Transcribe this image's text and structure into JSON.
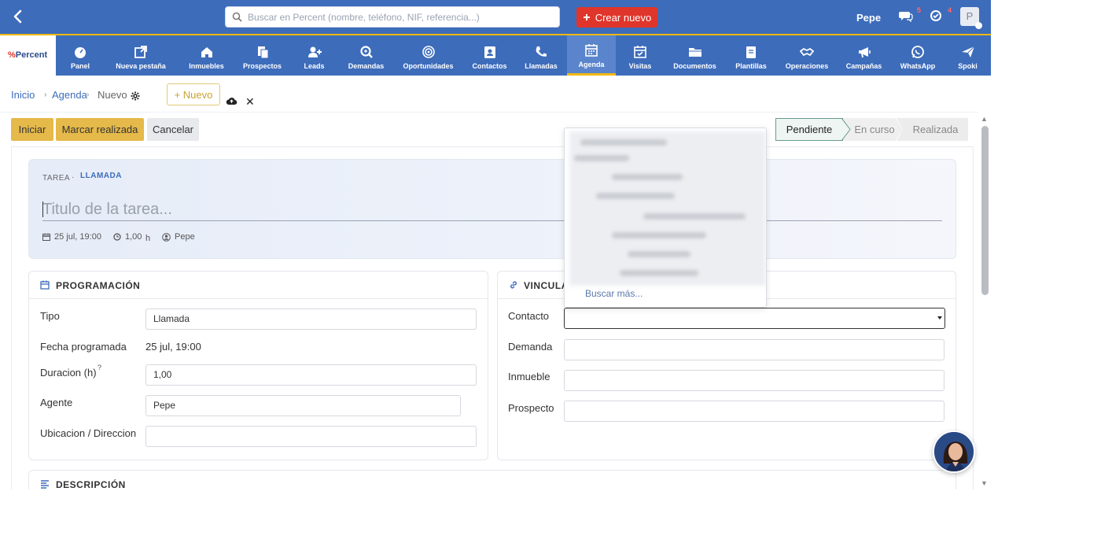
{
  "topbar": {
    "search_placeholder": "Buscar en Percent (nombre, teléfono, NIF, referencia...)",
    "create_label": "Crear nuevo",
    "user_name": "Pepe",
    "messages_count": "5",
    "notifications_count": "4",
    "avatar_letter": "P"
  },
  "logo": {
    "brand_prefix": "%",
    "brand_name": "Percent"
  },
  "nav": [
    {
      "label": "Panel",
      "icon": "dashboard-icon"
    },
    {
      "label": "Nueva pestaña",
      "icon": "new-tab-icon"
    },
    {
      "label": "Inmuebles",
      "icon": "home-icon"
    },
    {
      "label": "Prospectos",
      "icon": "documents-icon"
    },
    {
      "label": "Leads",
      "icon": "add-user-icon"
    },
    {
      "label": "Demandas",
      "icon": "search-icon"
    },
    {
      "label": "Oportunidades",
      "icon": "target-icon"
    },
    {
      "label": "Contactos",
      "icon": "contact-card-icon"
    },
    {
      "label": "Llamadas",
      "icon": "phone-icon"
    },
    {
      "label": "Agenda",
      "icon": "calendar-icon",
      "active": true
    },
    {
      "label": "Visitas",
      "icon": "calendar-check-icon"
    },
    {
      "label": "Documentos",
      "icon": "folder-icon"
    },
    {
      "label": "Plantillas",
      "icon": "template-icon"
    },
    {
      "label": "Operaciones",
      "icon": "handshake-icon"
    },
    {
      "label": "Campañas",
      "icon": "megaphone-icon"
    },
    {
      "label": "WhatsApp",
      "icon": "whatsapp-icon"
    },
    {
      "label": "Spoki",
      "icon": "send-icon"
    }
  ],
  "breadcrumb": {
    "home": "Inicio",
    "section": "Agenda",
    "current": "Nuevo"
  },
  "toolbar": {
    "new_label": "+ Nuevo"
  },
  "actions": {
    "start": "Iniciar",
    "mark_done": "Marcar realizada",
    "cancel": "Cancelar"
  },
  "status_steps": [
    "Pendiente",
    "En curso",
    "Realizada"
  ],
  "task": {
    "type": "TAREA",
    "separator": "·",
    "subtype": "LLAMADA",
    "title_placeholder": "Titulo de la tarea...",
    "date": "25 jul, 19:00",
    "duration": "1,00",
    "duration_unit": "h",
    "agent": "Pepe"
  },
  "programacion": {
    "title": "PROGRAMACIÓN",
    "tipo_label": "Tipo",
    "tipo_value": "Llamada",
    "fecha_label": "Fecha programada",
    "fecha_value": "25 jul, 19:00",
    "duracion_label": "Duracion (h)",
    "duracion_help": "?",
    "duracion_value": "1,00",
    "agente_label": "Agente",
    "agente_value": "Pepe",
    "ubicacion_label": "Ubicacion / Direccion",
    "ubicacion_value": ""
  },
  "vinculaciones": {
    "title": "VINCULAC",
    "contacto_label": "Contacto",
    "demanda_label": "Demanda",
    "inmueble_label": "Inmueble",
    "prospecto_label": "Prospecto"
  },
  "dropdown": {
    "more_label": "Buscar más..."
  },
  "descripcion": {
    "title": "DESCRIPCIÓN"
  },
  "colors": {
    "primary": "#3d6cbb",
    "accent": "#f2b90f",
    "danger": "#e0352b",
    "action": "#e5b94a"
  }
}
